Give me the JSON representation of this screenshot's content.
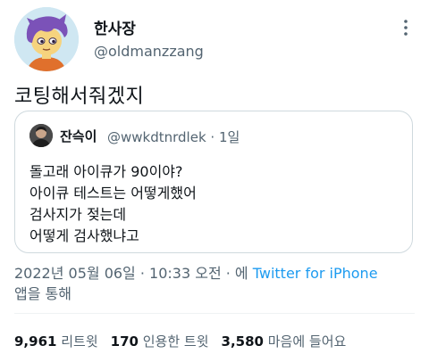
{
  "tweet": {
    "display_name": "한사장",
    "handle": "@oldmanzzang",
    "text": "코팅해서줘겠지",
    "timestamp": "2022년 05월 06일 · 10:33 오전 · 에 ",
    "source": "Twitter for iPhone",
    "source_suffix": "앱을 통해"
  },
  "quote": {
    "display_name": "잔슥이",
    "meta": "@wwkdtnrdlek · 1일",
    "lines": [
      "돌고래 아이큐가 90이야?",
      "아이큐 테스트는 어떻게했어",
      "검사지가 젖는데",
      "어떻게 검사했냐고"
    ]
  },
  "stats": {
    "retweets_count": "9,961",
    "retweets_label": "리트윗",
    "quotes_count": "170",
    "quotes_label": "인용한 트윗",
    "likes_count": "3,580",
    "likes_label": "마음에 들어요"
  },
  "icons": {
    "more": "more-vertical-icon"
  }
}
